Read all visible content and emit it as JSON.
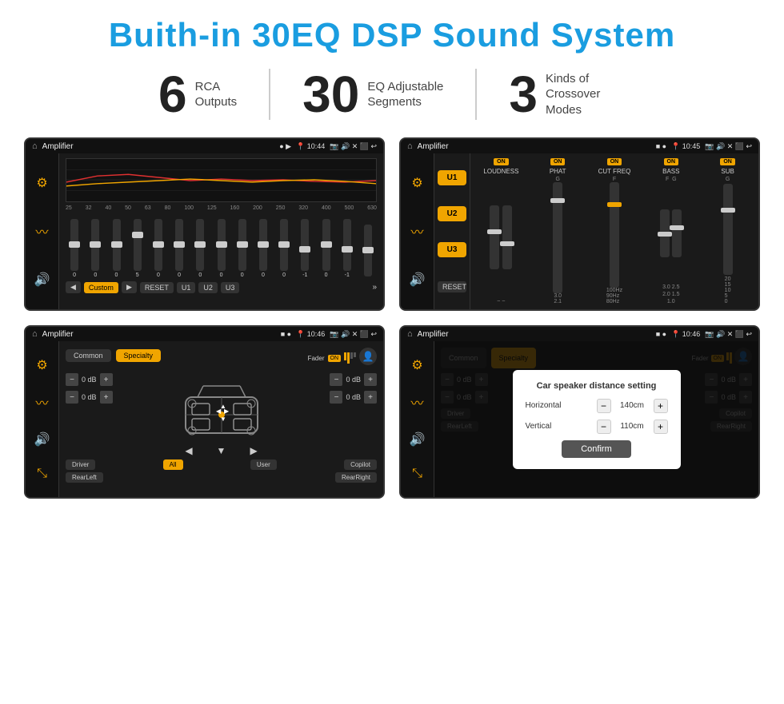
{
  "title": "Buith-in 30EQ DSP Sound System",
  "stats": [
    {
      "number": "6",
      "label": "RCA\nOutputs"
    },
    {
      "number": "30",
      "label": "EQ Adjustable\nSegments"
    },
    {
      "number": "3",
      "label": "Kinds of\nCrossover Modes"
    }
  ],
  "screens": [
    {
      "id": "screen1",
      "time": "10:44",
      "app": "Amplifier",
      "type": "eq",
      "eq_freqs": [
        "25",
        "32",
        "40",
        "50",
        "63",
        "80",
        "100",
        "125",
        "160",
        "200",
        "250",
        "320",
        "400",
        "500",
        "630"
      ],
      "eq_values": [
        "0",
        "0",
        "0",
        "5",
        "0",
        "0",
        "0",
        "0",
        "0",
        "0",
        "0",
        "-1",
        "0",
        "-1",
        ""
      ],
      "preset": "Custom",
      "buttons": [
        "U1",
        "U2",
        "U3"
      ]
    },
    {
      "id": "screen2",
      "time": "10:45",
      "app": "Amplifier",
      "type": "crossover",
      "u_buttons": [
        "U1",
        "U2",
        "U3"
      ],
      "channels": [
        "LOUDNESS",
        "PHAT",
        "CUT FREQ",
        "BASS",
        "SUB"
      ],
      "reset_label": "RESET"
    },
    {
      "id": "screen3",
      "time": "10:46",
      "app": "Amplifier",
      "type": "fader",
      "tabs": [
        "Common",
        "Specialty"
      ],
      "fader_label": "Fader",
      "db_values": [
        "0 dB",
        "0 dB",
        "0 dB",
        "0 dB"
      ],
      "bottom_buttons": [
        "Driver",
        "All",
        "User",
        "RearLeft",
        "Copilot",
        "RearRight"
      ]
    },
    {
      "id": "screen4",
      "time": "10:46",
      "app": "Amplifier",
      "type": "distance_dialog",
      "tabs": [
        "Common",
        "Specialty"
      ],
      "dialog": {
        "title": "Car speaker distance setting",
        "horizontal_label": "Horizontal",
        "horizontal_value": "140cm",
        "vertical_label": "Vertical",
        "vertical_value": "110cm",
        "confirm_label": "Confirm"
      },
      "db_values": [
        "0 dB",
        "0 dB"
      ],
      "bottom_buttons": [
        "Driver",
        "Copilot",
        "RearLeft",
        "RearRight"
      ]
    }
  ]
}
